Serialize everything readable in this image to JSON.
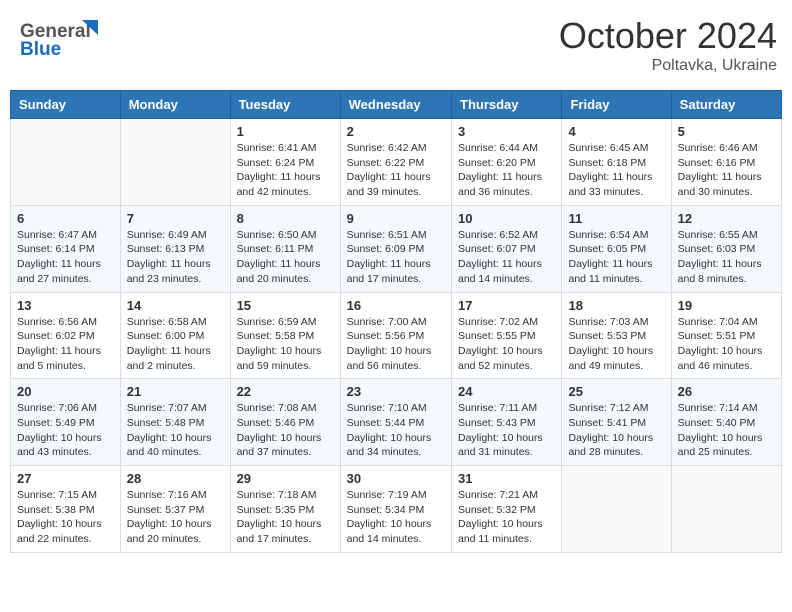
{
  "header": {
    "logo_line1": "General",
    "logo_line2": "Blue",
    "month": "October 2024",
    "location": "Poltavka, Ukraine"
  },
  "days_of_week": [
    "Sunday",
    "Monday",
    "Tuesday",
    "Wednesday",
    "Thursday",
    "Friday",
    "Saturday"
  ],
  "weeks": [
    [
      {
        "day": "",
        "info": ""
      },
      {
        "day": "",
        "info": ""
      },
      {
        "day": "1",
        "info": "Sunrise: 6:41 AM\nSunset: 6:24 PM\nDaylight: 11 hours and 42 minutes."
      },
      {
        "day": "2",
        "info": "Sunrise: 6:42 AM\nSunset: 6:22 PM\nDaylight: 11 hours and 39 minutes."
      },
      {
        "day": "3",
        "info": "Sunrise: 6:44 AM\nSunset: 6:20 PM\nDaylight: 11 hours and 36 minutes."
      },
      {
        "day": "4",
        "info": "Sunrise: 6:45 AM\nSunset: 6:18 PM\nDaylight: 11 hours and 33 minutes."
      },
      {
        "day": "5",
        "info": "Sunrise: 6:46 AM\nSunset: 6:16 PM\nDaylight: 11 hours and 30 minutes."
      }
    ],
    [
      {
        "day": "6",
        "info": "Sunrise: 6:47 AM\nSunset: 6:14 PM\nDaylight: 11 hours and 27 minutes."
      },
      {
        "day": "7",
        "info": "Sunrise: 6:49 AM\nSunset: 6:13 PM\nDaylight: 11 hours and 23 minutes."
      },
      {
        "day": "8",
        "info": "Sunrise: 6:50 AM\nSunset: 6:11 PM\nDaylight: 11 hours and 20 minutes."
      },
      {
        "day": "9",
        "info": "Sunrise: 6:51 AM\nSunset: 6:09 PM\nDaylight: 11 hours and 17 minutes."
      },
      {
        "day": "10",
        "info": "Sunrise: 6:52 AM\nSunset: 6:07 PM\nDaylight: 11 hours and 14 minutes."
      },
      {
        "day": "11",
        "info": "Sunrise: 6:54 AM\nSunset: 6:05 PM\nDaylight: 11 hours and 11 minutes."
      },
      {
        "day": "12",
        "info": "Sunrise: 6:55 AM\nSunset: 6:03 PM\nDaylight: 11 hours and 8 minutes."
      }
    ],
    [
      {
        "day": "13",
        "info": "Sunrise: 6:56 AM\nSunset: 6:02 PM\nDaylight: 11 hours and 5 minutes."
      },
      {
        "day": "14",
        "info": "Sunrise: 6:58 AM\nSunset: 6:00 PM\nDaylight: 11 hours and 2 minutes."
      },
      {
        "day": "15",
        "info": "Sunrise: 6:59 AM\nSunset: 5:58 PM\nDaylight: 10 hours and 59 minutes."
      },
      {
        "day": "16",
        "info": "Sunrise: 7:00 AM\nSunset: 5:56 PM\nDaylight: 10 hours and 56 minutes."
      },
      {
        "day": "17",
        "info": "Sunrise: 7:02 AM\nSunset: 5:55 PM\nDaylight: 10 hours and 52 minutes."
      },
      {
        "day": "18",
        "info": "Sunrise: 7:03 AM\nSunset: 5:53 PM\nDaylight: 10 hours and 49 minutes."
      },
      {
        "day": "19",
        "info": "Sunrise: 7:04 AM\nSunset: 5:51 PM\nDaylight: 10 hours and 46 minutes."
      }
    ],
    [
      {
        "day": "20",
        "info": "Sunrise: 7:06 AM\nSunset: 5:49 PM\nDaylight: 10 hours and 43 minutes."
      },
      {
        "day": "21",
        "info": "Sunrise: 7:07 AM\nSunset: 5:48 PM\nDaylight: 10 hours and 40 minutes."
      },
      {
        "day": "22",
        "info": "Sunrise: 7:08 AM\nSunset: 5:46 PM\nDaylight: 10 hours and 37 minutes."
      },
      {
        "day": "23",
        "info": "Sunrise: 7:10 AM\nSunset: 5:44 PM\nDaylight: 10 hours and 34 minutes."
      },
      {
        "day": "24",
        "info": "Sunrise: 7:11 AM\nSunset: 5:43 PM\nDaylight: 10 hours and 31 minutes."
      },
      {
        "day": "25",
        "info": "Sunrise: 7:12 AM\nSunset: 5:41 PM\nDaylight: 10 hours and 28 minutes."
      },
      {
        "day": "26",
        "info": "Sunrise: 7:14 AM\nSunset: 5:40 PM\nDaylight: 10 hours and 25 minutes."
      }
    ],
    [
      {
        "day": "27",
        "info": "Sunrise: 7:15 AM\nSunset: 5:38 PM\nDaylight: 10 hours and 22 minutes."
      },
      {
        "day": "28",
        "info": "Sunrise: 7:16 AM\nSunset: 5:37 PM\nDaylight: 10 hours and 20 minutes."
      },
      {
        "day": "29",
        "info": "Sunrise: 7:18 AM\nSunset: 5:35 PM\nDaylight: 10 hours and 17 minutes."
      },
      {
        "day": "30",
        "info": "Sunrise: 7:19 AM\nSunset: 5:34 PM\nDaylight: 10 hours and 14 minutes."
      },
      {
        "day": "31",
        "info": "Sunrise: 7:21 AM\nSunset: 5:32 PM\nDaylight: 10 hours and 11 minutes."
      },
      {
        "day": "",
        "info": ""
      },
      {
        "day": "",
        "info": ""
      }
    ]
  ]
}
